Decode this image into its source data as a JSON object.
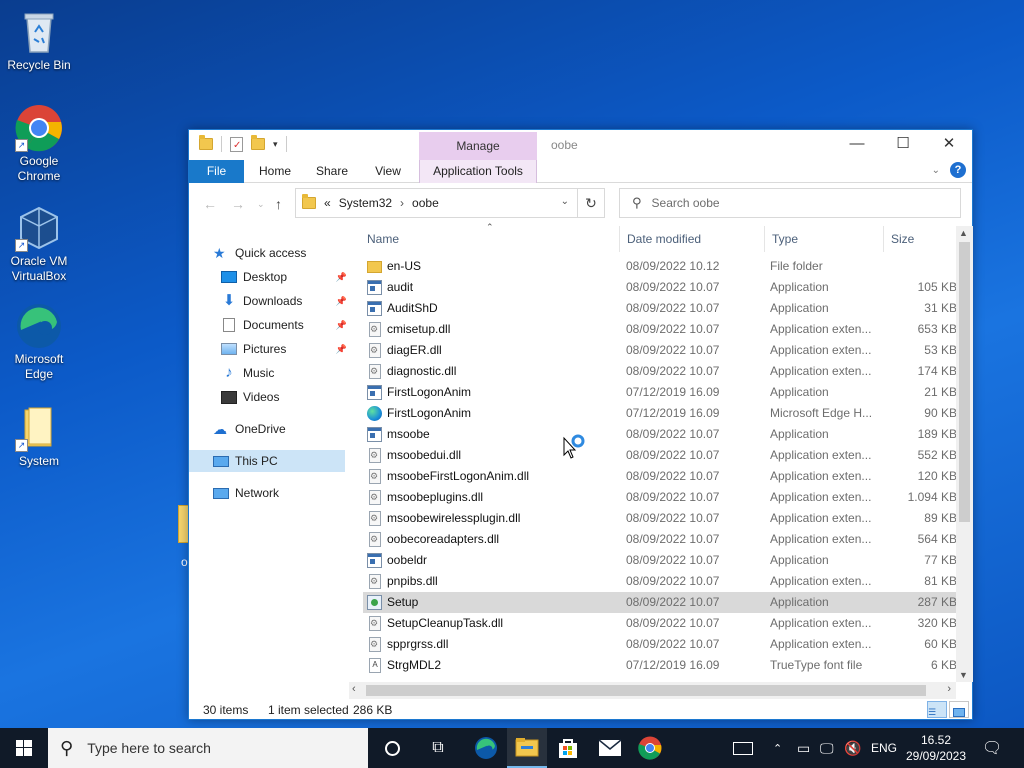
{
  "desktop": {
    "icons": [
      {
        "label": "Recycle Bin"
      },
      {
        "label": "Google Chrome"
      },
      {
        "label": "Oracle VM VirtualBox"
      },
      {
        "label": "Microsoft Edge"
      },
      {
        "label": "System"
      }
    ],
    "partial_label": "o"
  },
  "window": {
    "title": "oobe",
    "contextual_group": "Manage",
    "controls": {
      "minimize": "—",
      "maximize": "☐",
      "close": "✕"
    },
    "ribbon_tabs": [
      "File",
      "Home",
      "Share",
      "View",
      "Application Tools"
    ],
    "address": {
      "prefix": "«",
      "segments": [
        "System32",
        "oobe"
      ]
    },
    "search_placeholder": "Search oobe",
    "columns": {
      "name": "Name",
      "date": "Date modified",
      "type": "Type",
      "size": "Size"
    },
    "nav": {
      "quick_access": "Quick access",
      "desktop": "Desktop",
      "downloads": "Downloads",
      "documents": "Documents",
      "pictures": "Pictures",
      "music": "Music",
      "videos": "Videos",
      "onedrive": "OneDrive",
      "this_pc": "This PC",
      "network": "Network"
    },
    "files": [
      {
        "name": "en-US",
        "date": "08/09/2022 10.12",
        "type": "File folder",
        "size": "",
        "icon": "folder"
      },
      {
        "name": "audit",
        "date": "08/09/2022 10.07",
        "type": "Application",
        "size": "105 KB",
        "icon": "app"
      },
      {
        "name": "AuditShD",
        "date": "08/09/2022 10.07",
        "type": "Application",
        "size": "31 KB",
        "icon": "app"
      },
      {
        "name": "cmisetup.dll",
        "date": "08/09/2022 10.07",
        "type": "Application exten...",
        "size": "653 KB",
        "icon": "dll"
      },
      {
        "name": "diagER.dll",
        "date": "08/09/2022 10.07",
        "type": "Application exten...",
        "size": "53 KB",
        "icon": "dll"
      },
      {
        "name": "diagnostic.dll",
        "date": "08/09/2022 10.07",
        "type": "Application exten...",
        "size": "174 KB",
        "icon": "dll"
      },
      {
        "name": "FirstLogonAnim",
        "date": "07/12/2019 16.09",
        "type": "Application",
        "size": "21 KB",
        "icon": "app"
      },
      {
        "name": "FirstLogonAnim",
        "date": "07/12/2019 16.09",
        "type": "Microsoft Edge H...",
        "size": "90 KB",
        "icon": "edge"
      },
      {
        "name": "msoobe",
        "date": "08/09/2022 10.07",
        "type": "Application",
        "size": "189 KB",
        "icon": "app"
      },
      {
        "name": "msoobedui.dll",
        "date": "08/09/2022 10.07",
        "type": "Application exten...",
        "size": "552 KB",
        "icon": "dll"
      },
      {
        "name": "msoobeFirstLogonAnim.dll",
        "date": "08/09/2022 10.07",
        "type": "Application exten...",
        "size": "120 KB",
        "icon": "dll"
      },
      {
        "name": "msoobeplugins.dll",
        "date": "08/09/2022 10.07",
        "type": "Application exten...",
        "size": "1.094 KB",
        "icon": "dll"
      },
      {
        "name": "msoobewirelessplugin.dll",
        "date": "08/09/2022 10.07",
        "type": "Application exten...",
        "size": "89 KB",
        "icon": "dll"
      },
      {
        "name": "oobecoreadapters.dll",
        "date": "08/09/2022 10.07",
        "type": "Application exten...",
        "size": "564 KB",
        "icon": "dll"
      },
      {
        "name": "oobeldr",
        "date": "08/09/2022 10.07",
        "type": "Application",
        "size": "77 KB",
        "icon": "app"
      },
      {
        "name": "pnpibs.dll",
        "date": "08/09/2022 10.07",
        "type": "Application exten...",
        "size": "81 KB",
        "icon": "dll"
      },
      {
        "name": "Setup",
        "date": "08/09/2022 10.07",
        "type": "Application",
        "size": "287 KB",
        "icon": "setup",
        "selected": true
      },
      {
        "name": "SetupCleanupTask.dll",
        "date": "08/09/2022 10.07",
        "type": "Application exten...",
        "size": "320 KB",
        "icon": "dll"
      },
      {
        "name": "spprgrss.dll",
        "date": "08/09/2022 10.07",
        "type": "Application exten...",
        "size": "60 KB",
        "icon": "dll"
      },
      {
        "name": "StrgMDL2",
        "date": "07/12/2019 16.09",
        "type": "TrueType font file",
        "size": "6 KB",
        "icon": "font"
      }
    ],
    "status": {
      "items": "30 items",
      "selected": "1 item selected",
      "size": "286 KB"
    }
  },
  "taskbar": {
    "search_placeholder": "Type here to search",
    "language": "ENG",
    "time": "16.52",
    "date": "29/09/2023"
  }
}
